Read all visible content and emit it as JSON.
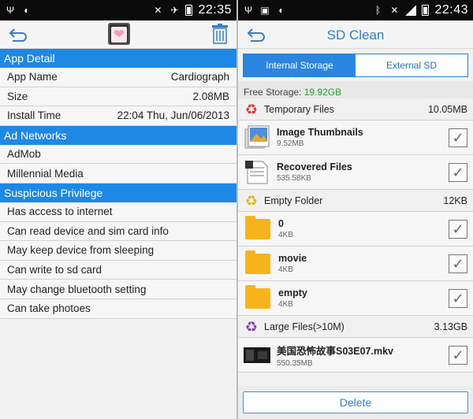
{
  "left": {
    "status": {
      "time": "22:35"
    },
    "sections": [
      {
        "title": "App Detail",
        "rows": [
          {
            "label": "App Name",
            "value": "Cardiograph"
          },
          {
            "label": "Size",
            "value": "2.08MB"
          },
          {
            "label": "Install Time",
            "value": "22:04 Thu, Jun/06/2013"
          }
        ]
      },
      {
        "title": "Ad Networks",
        "rows": [
          {
            "label": "AdMob",
            "value": ""
          },
          {
            "label": "Millennial Media",
            "value": ""
          }
        ]
      },
      {
        "title": "Suspicious Privilege",
        "rows": [
          {
            "label": "Has access to internet",
            "value": ""
          },
          {
            "label": "Can read device and sim card info",
            "value": ""
          },
          {
            "label": "May keep device from sleeping",
            "value": ""
          },
          {
            "label": "Can write to sd card",
            "value": ""
          },
          {
            "label": "May change bluetooth setting",
            "value": ""
          },
          {
            "label": "Can take photoes",
            "value": ""
          }
        ]
      }
    ]
  },
  "right": {
    "status": {
      "time": "22:43"
    },
    "title": "SD Clean",
    "tabs": {
      "internal": "Internal Storage",
      "external": "External SD"
    },
    "free_storage": {
      "label": "Free Storage: ",
      "value": "19.92GB"
    },
    "categories": [
      {
        "name": "Temporary Files",
        "size": "10.05MB",
        "icon_color": "#d93a2b"
      },
      {
        "name": "Empty Folder",
        "size": "12KB",
        "icon_color": "#e2b21d"
      },
      {
        "name": "Large Files(>10M)",
        "size": "3.13GB",
        "icon_color": "#8b3fb3"
      }
    ],
    "temp_items": [
      {
        "name": "Image Thumbnails",
        "size": "9.52MB"
      },
      {
        "name": "Recovered Files",
        "size": "535.58KB"
      }
    ],
    "folder_items": [
      {
        "name": "0",
        "size": "4KB"
      },
      {
        "name": "movie",
        "size": "4KB"
      },
      {
        "name": "empty",
        "size": "4KB"
      }
    ],
    "large_items": [
      {
        "name": "美国恐怖故事S03E07.mkv",
        "size": "550.35MB"
      }
    ],
    "delete_label": "Delete"
  }
}
